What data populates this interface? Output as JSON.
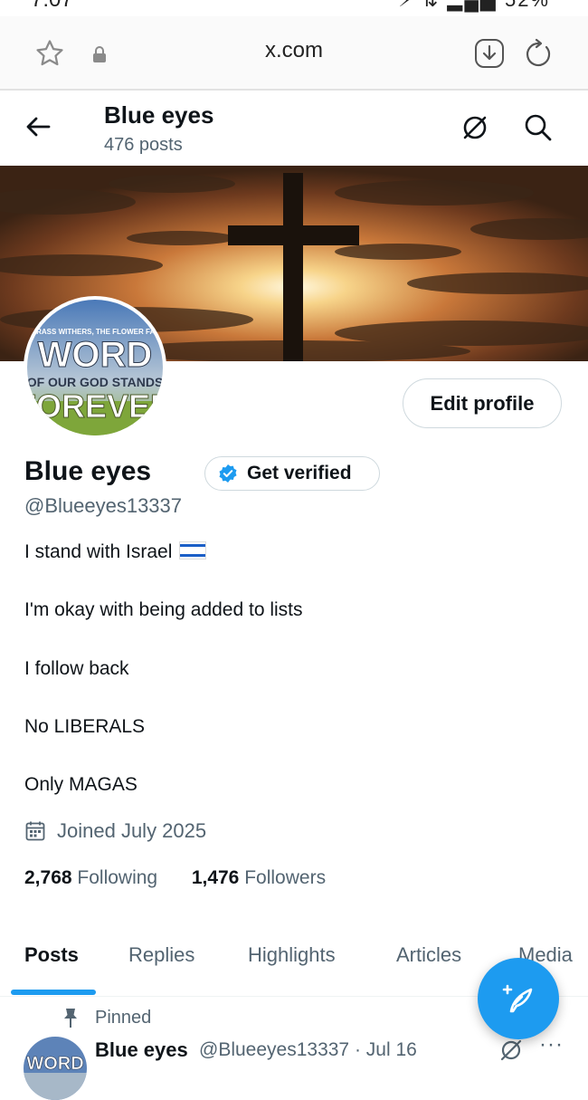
{
  "status_bar": {
    "time": "7:07",
    "icons": "⚡ ⇅ ▂▄▆ 52%"
  },
  "browser": {
    "url": "x.com"
  },
  "header": {
    "title": "Blue eyes",
    "posts_count": "476 posts"
  },
  "avatar_art": {
    "line1": "THE GRASS WITHERS, THE FLOWER FADES...",
    "line2": "WORD",
    "line3": "OF OUR GOD STANDS",
    "line4": "FOREVER"
  },
  "profile": {
    "edit_label": "Edit profile",
    "name": "Blue eyes",
    "verify_label": "Get verified",
    "handle": "@Blueeyes13337",
    "bio": [
      "I stand with Israel",
      "I'm okay with being added to lists",
      "I follow back",
      "No LIBERALS",
      "Only MAGAS"
    ],
    "joined": "Joined July 2025",
    "following_count": "2,768",
    "following_label": "Following",
    "followers_count": "1,476",
    "followers_label": "Followers"
  },
  "tabs": [
    {
      "label": "Posts",
      "active": true
    },
    {
      "label": "Replies"
    },
    {
      "label": "Highlights"
    },
    {
      "label": "Articles"
    },
    {
      "label": "Media"
    }
  ],
  "pinned_post": {
    "pinned_label": "Pinned",
    "author": "Blue eyes",
    "meta": "@Blueeyes13337 · Jul 16",
    "more": "···"
  },
  "colors": {
    "accent": "#1d9bf0",
    "text": "#0f1419",
    "secondary": "#536471"
  },
  "icons": {
    "bookmark": "star-icon",
    "lock": "lock-icon",
    "download": "download-icon",
    "reload": "reload-icon",
    "back": "back-arrow-icon",
    "grok": "grok-icon",
    "search": "search-icon",
    "verified": "verified-badge-icon",
    "calendar": "calendar-icon",
    "pin": "pin-icon",
    "compose": "compose-post-icon"
  }
}
